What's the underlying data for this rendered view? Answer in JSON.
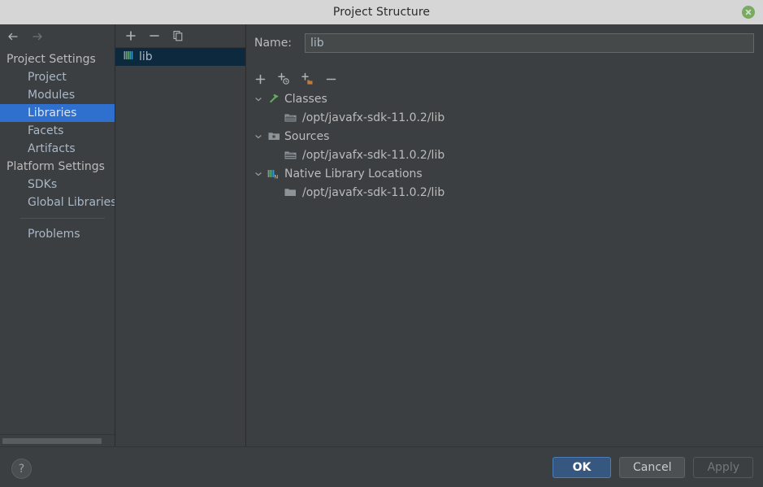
{
  "window": {
    "title": "Project Structure",
    "close_icon": "close-circle-icon"
  },
  "sidebar": {
    "back_icon": "arrow-left-icon",
    "forward_icon": "arrow-right-icon",
    "groups": [
      {
        "label": "Project Settings",
        "items": [
          {
            "label": "Project",
            "selected": false
          },
          {
            "label": "Modules",
            "selected": false
          },
          {
            "label": "Libraries",
            "selected": true
          },
          {
            "label": "Facets",
            "selected": false
          },
          {
            "label": "Artifacts",
            "selected": false
          }
        ]
      },
      {
        "label": "Platform Settings",
        "items": [
          {
            "label": "SDKs",
            "selected": false
          },
          {
            "label": "Global Libraries",
            "selected": false
          }
        ]
      }
    ],
    "footer_items": [
      {
        "label": "Problems",
        "selected": false
      }
    ]
  },
  "library_panel": {
    "toolbar": [
      {
        "name": "add-button",
        "icon": "plus-icon",
        "label": "+"
      },
      {
        "name": "remove-button",
        "icon": "minus-icon",
        "label": "−"
      },
      {
        "name": "copy-button",
        "icon": "copy-icon",
        "label": "Copy"
      }
    ],
    "items": [
      {
        "label": "lib",
        "icon": "library-icon",
        "selected": true
      }
    ]
  },
  "detail": {
    "name_label": "Name:",
    "name_value": "lib",
    "name_placeholder": "",
    "toolbar": [
      {
        "name": "add-root-button",
        "icon": "plus-icon"
      },
      {
        "name": "attach-classes-button",
        "icon": "plus-circle-icon"
      },
      {
        "name": "attach-folder-button",
        "icon": "plus-folder-icon"
      },
      {
        "name": "remove-root-button",
        "icon": "minus-icon"
      }
    ],
    "roots": [
      {
        "label": "Classes",
        "icon": "classes-hammer-icon",
        "expanded": true,
        "twisty": "chevron-down-icon",
        "children": [
          {
            "label": "/opt/javafx-sdk-11.0.2/lib",
            "icon": "jar-folder-icon"
          }
        ]
      },
      {
        "label": "Sources",
        "icon": "sources-folder-icon",
        "expanded": true,
        "twisty": "chevron-down-icon",
        "children": [
          {
            "label": "/opt/javafx-sdk-11.0.2/lib",
            "icon": "jar-folder-icon"
          }
        ]
      },
      {
        "label": "Native Library Locations",
        "icon": "native-library-icon",
        "expanded": true,
        "twisty": "chevron-down-icon",
        "children": [
          {
            "label": "/opt/javafx-sdk-11.0.2/lib",
            "icon": "folder-icon"
          }
        ]
      }
    ]
  },
  "footer": {
    "help_label": "?",
    "buttons": [
      {
        "label": "OK",
        "style": "default"
      },
      {
        "label": "Cancel",
        "style": "normal"
      },
      {
        "label": "Apply",
        "style": "disabled"
      }
    ]
  },
  "colors": {
    "window_bg": "#3c3f41",
    "titlebar_bg": "#d6d6d6",
    "selection_blue": "#2f6fce",
    "list_selection": "#0d293e",
    "default_button": "#365880",
    "close_green": "#7aab62",
    "text": "#bbbbbb",
    "link_text": "#a9b7c6"
  }
}
